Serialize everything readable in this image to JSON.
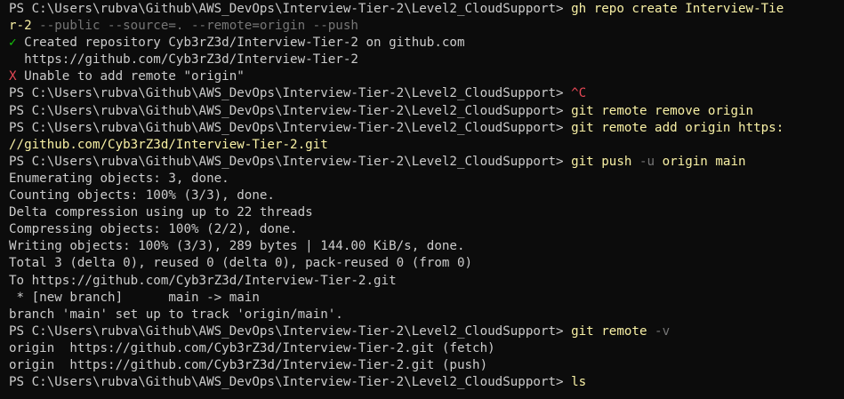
{
  "terminal": {
    "prompt": "PS C:\\Users\\rubva\\Github\\AWS_DevOps\\Interview-Tier-2\\Level2_CloudSupport> ",
    "lines": [
      {
        "type": "prompt",
        "cmd": "gh",
        "rest": " repo create Interview-Tie"
      },
      {
        "type": "wrap",
        "parts": [
          {
            "t": "r-2",
            "c": "cmd"
          },
          {
            "t": " --public --source=. --remote=origin --push",
            "c": "flag"
          }
        ]
      },
      {
        "type": "status",
        "icon": "✓",
        "iconClass": "ok",
        "text": " Created repository Cyb3rZ3d/Interview-Tier-2 on github.com"
      },
      {
        "type": "plain",
        "text": "  https://github.com/Cyb3rZ3d/Interview-Tier-2"
      },
      {
        "type": "status",
        "icon": "X",
        "iconClass": "err",
        "text": " Unable to add remote \"origin\""
      },
      {
        "type": "prompt",
        "cmd": "^C",
        "cmdClass": "err",
        "rest": ""
      },
      {
        "type": "prompt",
        "cmd": "git",
        "rest": " remote remove origin"
      },
      {
        "type": "prompt",
        "cmd": "git",
        "rest": " remote add origin https:"
      },
      {
        "type": "wrap",
        "parts": [
          {
            "t": "//github.com/Cyb3rZ3d/Interview-Tier-2.git",
            "c": "cmd"
          }
        ]
      },
      {
        "type": "prompt",
        "cmd": "git",
        "rest": " push ",
        "flag": "-u",
        "rest2": " origin main"
      },
      {
        "type": "plain",
        "text": "Enumerating objects: 3, done."
      },
      {
        "type": "plain",
        "text": "Counting objects: 100% (3/3), done."
      },
      {
        "type": "plain",
        "text": "Delta compression using up to 22 threads"
      },
      {
        "type": "plain",
        "text": "Compressing objects: 100% (2/2), done."
      },
      {
        "type": "plain",
        "text": "Writing objects: 100% (3/3), 289 bytes | 144.00 KiB/s, done."
      },
      {
        "type": "plain",
        "text": "Total 3 (delta 0), reused 0 (delta 0), pack-reused 0 (from 0)"
      },
      {
        "type": "plain",
        "text": "To https://github.com/Cyb3rZ3d/Interview-Tier-2.git"
      },
      {
        "type": "plain",
        "text": " * [new branch]      main -> main"
      },
      {
        "type": "plain",
        "text": "branch 'main' set up to track 'origin/main'."
      },
      {
        "type": "prompt",
        "cmd": "git",
        "rest": " remote ",
        "flag": "-v",
        "rest2": ""
      },
      {
        "type": "plain",
        "text": "origin  https://github.com/Cyb3rZ3d/Interview-Tier-2.git (fetch)"
      },
      {
        "type": "plain",
        "text": "origin  https://github.com/Cyb3rZ3d/Interview-Tier-2.git (push)"
      },
      {
        "type": "prompt",
        "cmd": "ls",
        "rest": ""
      }
    ]
  },
  "colors": {
    "background": "#0c0c0c",
    "text": "#cccccc",
    "command": "#f9f1a5",
    "flag": "#767676",
    "success": "#16c60c",
    "error": "#e74856"
  }
}
